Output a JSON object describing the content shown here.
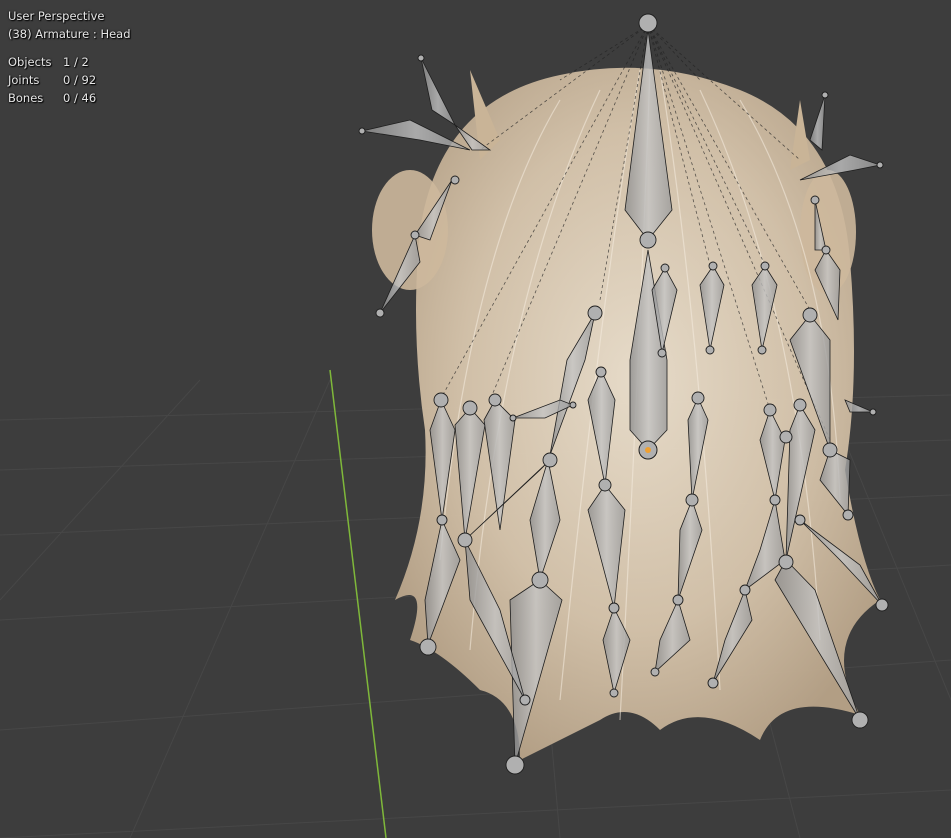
{
  "viewport": {
    "view_name": "User Perspective",
    "active_object": "(38) Armature : Head",
    "stats": [
      {
        "label": "Objects",
        "value": "1 / 2"
      },
      {
        "label": "Joints",
        "value": "0 / 92"
      },
      {
        "label": "Bones",
        "value": "0 / 46"
      }
    ]
  },
  "colors": {
    "background": "#3d3d3d",
    "grid": "#4a4a4a",
    "y_axis": "#7fb83a",
    "hair": "#d8c6ad",
    "bone": "#a9a9a9",
    "active_joint": "#f0a030"
  }
}
